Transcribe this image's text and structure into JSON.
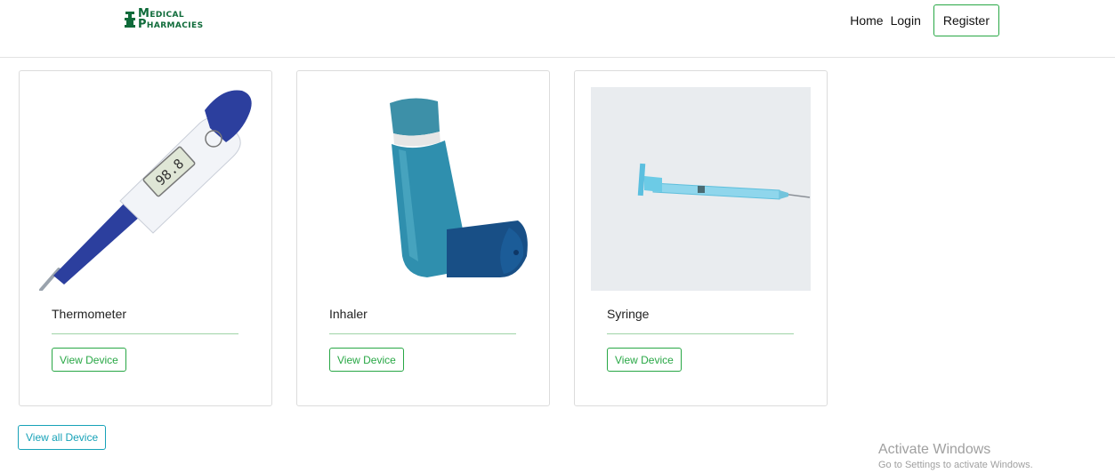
{
  "header": {
    "logo": {
      "line1": "Medical",
      "line2": "Pharmacies"
    },
    "nav": {
      "home": "Home",
      "login": "Login",
      "register": "Register"
    }
  },
  "devices": [
    {
      "name": "Thermometer",
      "button": "View Device",
      "image": "thermometer-image"
    },
    {
      "name": "Inhaler",
      "button": "View Device",
      "image": "inhaler-image"
    },
    {
      "name": "Syringe",
      "button": "View Device",
      "image": "syringe-image"
    }
  ],
  "view_all_label": "View all Device",
  "watermark": {
    "title": "Activate Windows",
    "subtitle": "Go to Settings to activate Windows."
  },
  "colors": {
    "brand": "#0f6b3a",
    "success": "#28a745",
    "info": "#17a2b8"
  }
}
